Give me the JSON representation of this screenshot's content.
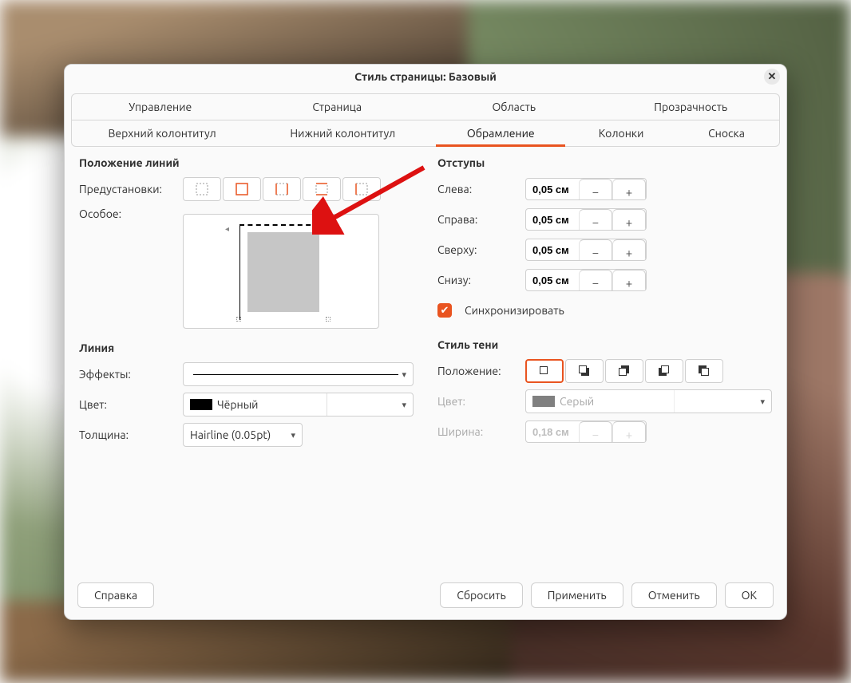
{
  "title": "Стиль страницы: Базовый",
  "tabs_row1": {
    "management": "Управление",
    "page": "Страница",
    "area": "Область",
    "transparency": "Прозрачность"
  },
  "tabs_row2": {
    "header": "Верхний колонтитул",
    "footer": "Нижний колонтитул",
    "borders": "Обрамление",
    "columns": "Колонки",
    "footnote": "Сноска"
  },
  "lines": {
    "section": "Положение линий",
    "presets_label": "Предустановки:",
    "custom_label": "Особое:"
  },
  "line_style": {
    "section": "Линия",
    "effects_label": "Эффекты:",
    "color_label": "Цвет:",
    "color_value": "Чёрный",
    "color_hex": "#000000",
    "width_label": "Толщина:",
    "width_value": "Hairline (0.05pt)"
  },
  "padding": {
    "section": "Отступы",
    "left_label": "Слева:",
    "right_label": "Справа:",
    "top_label": "Сверху:",
    "bottom_label": "Снизу:",
    "left_value": "0,05 см",
    "right_value": "0,05 см",
    "top_value": "0,05 см",
    "bottom_value": "0,05 см",
    "sync_label": "Синхронизировать",
    "sync_checked": true
  },
  "shadow": {
    "section": "Стиль тени",
    "position_label": "Положение:",
    "color_label": "Цвет:",
    "color_value": "Серый",
    "color_hex": "#808080",
    "width_label": "Ширина:",
    "width_value": "0,18 см",
    "selected_index": 0
  },
  "buttons": {
    "help": "Справка",
    "reset": "Сбросить",
    "apply": "Применить",
    "cancel": "Отменить",
    "ok": "ОК"
  },
  "annotation": "red-arrow-pointing-to-top-dashed-border-in-preview"
}
